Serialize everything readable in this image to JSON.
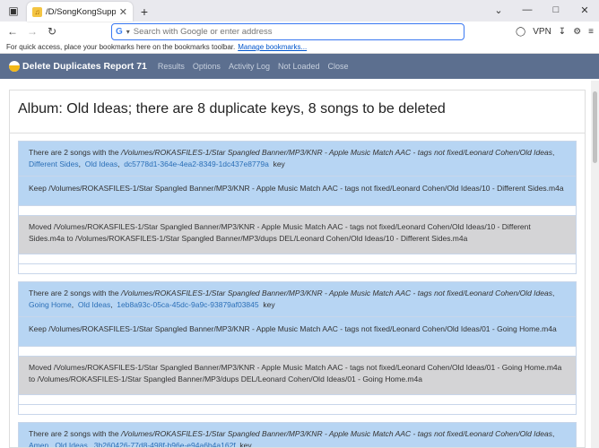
{
  "browser": {
    "tab_title": "/D/SongKongSupport/cnrokas",
    "url_placeholder": "Search with Google or enter address",
    "vpn_label": "VPN",
    "bookmarks_text": "For quick access, place your bookmarks here on the bookmarks toolbar.",
    "bookmarks_link": "Manage bookmarks..."
  },
  "app": {
    "title": "Delete Duplicates Report 71",
    "nav": [
      "Results",
      "Options",
      "Activity Log",
      "Not Loaded",
      "Close"
    ]
  },
  "album_title": "Album: Old Ideas; there are 8 duplicate keys, 8 songs to be deleted",
  "entries": [
    {
      "prefix": "There are 2 songs with the ",
      "path": "/Volumes/ROKASFILES-1/Star Spangled Banner/MP3/KNR - Apple Music Match AAC - tags not fixed/Leonard Cohen/Old Ideas",
      "song": "Different Sides",
      "album": "Old Ideas",
      "key_id": "dc5778d1-364e-4ea2-8349-1dc437e8779a",
      "key_suffix": "key",
      "keep": "Keep /Volumes/ROKASFILES-1/Star Spangled Banner/MP3/KNR - Apple Music Match AAC - tags not fixed/Leonard Cohen/Old Ideas/10 - Different Sides.m4a",
      "moved": "Moved /Volumes/ROKASFILES-1/Star Spangled Banner/MP3/KNR - Apple Music Match AAC - tags not fixed/Leonard Cohen/Old Ideas/10 - Different Sides.m4a to /Volumes/ROKASFILES-1/Star Spangled Banner/MP3/dups DEL/Leonard Cohen/Old Ideas/10 - Different Sides.m4a"
    },
    {
      "prefix": "There are 2 songs with the ",
      "path": "/Volumes/ROKASFILES-1/Star Spangled Banner/MP3/KNR - Apple Music Match AAC - tags not fixed/Leonard Cohen/Old Ideas",
      "song": "Going Home",
      "album": "Old Ideas",
      "key_id": "1eb8a93c-05ca-45dc-9a9c-93879af03845",
      "key_suffix": "key",
      "keep": "Keep /Volumes/ROKASFILES-1/Star Spangled Banner/MP3/KNR - Apple Music Match AAC - tags not fixed/Leonard Cohen/Old Ideas/01 - Going Home.m4a",
      "moved": "Moved /Volumes/ROKASFILES-1/Star Spangled Banner/MP3/KNR - Apple Music Match AAC - tags not fixed/Leonard Cohen/Old Ideas/01 - Going Home.m4a to /Volumes/ROKASFILES-1/Star Spangled Banner/MP3/dups DEL/Leonard Cohen/Old Ideas/01 - Going Home.m4a"
    },
    {
      "prefix": "There are 2 songs with the ",
      "path": "/Volumes/ROKASFILES-1/Star Spangled Banner/MP3/KNR - Apple Music Match AAC - tags not fixed/Leonard Cohen/Old Ideas",
      "song": "Amen",
      "album": "Old Ideas",
      "key_id": "3b260426-77d8-498f-b96e-e94a6b4a162f",
      "key_suffix": "key"
    }
  ]
}
